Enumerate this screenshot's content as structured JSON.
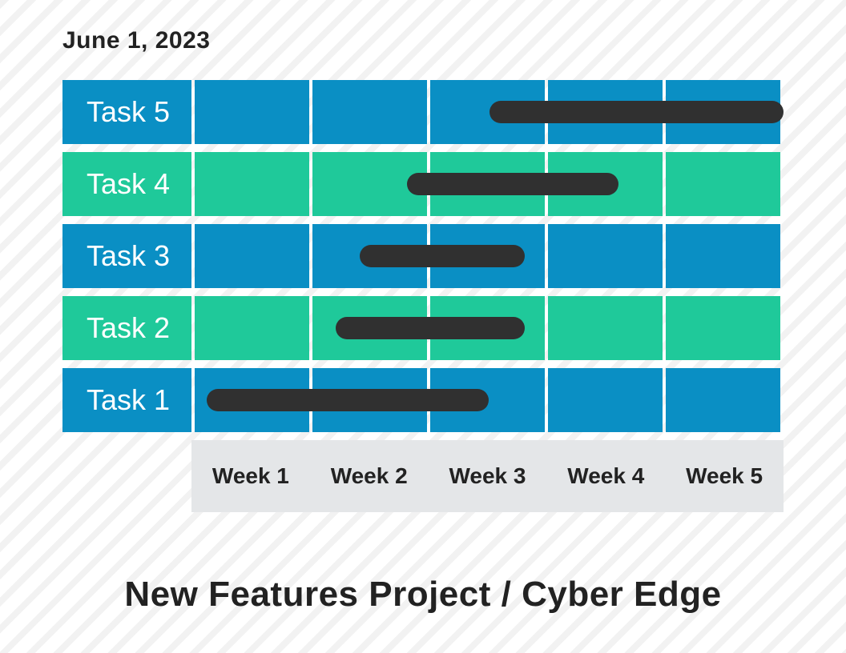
{
  "date": "June 1, 2023",
  "title": "New Features Project / Cyber Edge",
  "weeks": [
    "Week 1",
    "Week 2",
    "Week 3",
    "Week 4",
    "Week 5"
  ],
  "rows": [
    {
      "label": "Task 5",
      "color": "blue"
    },
    {
      "label": "Task 4",
      "color": "green"
    },
    {
      "label": "Task 3",
      "color": "blue"
    },
    {
      "label": "Task 2",
      "color": "green"
    },
    {
      "label": "Task 1",
      "color": "blue"
    }
  ],
  "chart_data": {
    "type": "bar",
    "title": "New Features Project / Cyber Edge",
    "xlabel": "",
    "ylabel": "",
    "categories": [
      "Week 1",
      "Week 2",
      "Week 3",
      "Week 4",
      "Week 5"
    ],
    "xlim": [
      0,
      5
    ],
    "series": [
      {
        "name": "Task 1",
        "start": 0.1,
        "end": 2.5
      },
      {
        "name": "Task 2",
        "start": 1.2,
        "end": 2.8
      },
      {
        "name": "Task 3",
        "start": 1.4,
        "end": 2.8
      },
      {
        "name": "Task 4",
        "start": 1.8,
        "end": 3.6
      },
      {
        "name": "Task 5",
        "start": 2.5,
        "end": 5.0
      }
    ]
  }
}
